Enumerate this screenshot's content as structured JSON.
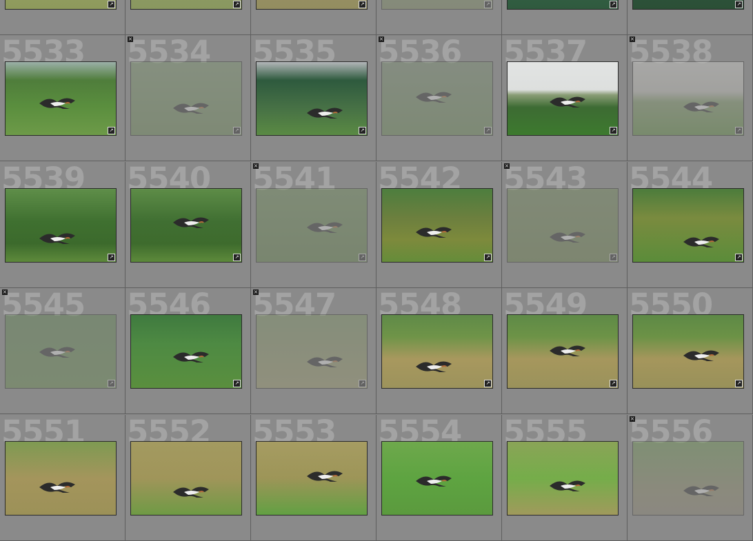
{
  "grid": {
    "cells": [
      {
        "num": "",
        "rejected": false,
        "dim": false,
        "bg": "linear-gradient(180deg,#9aa36a 0%,#8e9a5c 100%)",
        "bird": false,
        "badge": "badge-icon"
      },
      {
        "num": "",
        "rejected": false,
        "dim": false,
        "bg": "linear-gradient(180deg,#98a56a 0%,#899760 100%)",
        "bird": false,
        "badge": "badge-icon"
      },
      {
        "num": "",
        "rejected": false,
        "dim": false,
        "bg": "linear-gradient(180deg,#a49a6c 0%,#938d60 100%)",
        "bird": false,
        "badge": "badge-icon"
      },
      {
        "num": "",
        "rejected": false,
        "dim": true,
        "bg": "linear-gradient(180deg,#85956c 0%,#7e8c60 100%)",
        "bird": false,
        "badge": "badge-icon"
      },
      {
        "num": "",
        "rejected": false,
        "dim": false,
        "bg": "linear-gradient(180deg,#3f6e58 0%,#2f5a3e 100%)",
        "bird": false,
        "badge": "badge-icon"
      },
      {
        "num": "",
        "rejected": false,
        "dim": false,
        "bg": "linear-gradient(180deg,#375f4c 0%,#2b4f36 100%)",
        "bird": false,
        "badge": "badge-icon"
      },
      {
        "num": "5533",
        "rejected": false,
        "dim": false,
        "bg": "linear-gradient(180deg,#9bb0a8 0%,#4f7d3b 25%,#5a8e3e 60%,#6d9a48 100%)",
        "bird": true,
        "badge": "badge-icon"
      },
      {
        "num": "5534",
        "rejected": true,
        "dim": true,
        "bg": "linear-gradient(180deg,#7f9a70 0%,#6d8a55 100%)",
        "bird": true,
        "badge": "badge-icon"
      },
      {
        "num": "5535",
        "rejected": false,
        "dim": false,
        "bg": "linear-gradient(180deg,#b3b6b9 0%,#2e5a3e 25%,#456f45 60%,#5a8a44 100%)",
        "bird": true,
        "badge": "badge-icon"
      },
      {
        "num": "5536",
        "rejected": true,
        "dim": true,
        "bg": "linear-gradient(180deg,#7d9273 0%,#6b8a55 100%)",
        "bird": true,
        "badge": "badge-icon"
      },
      {
        "num": "5537",
        "rejected": false,
        "dim": false,
        "bg": "linear-gradient(180deg,#e2e4e3 0%,#dddfde 38%,#8a9d76 45%,#3d6b33 62%,#3d7a2e 100%)",
        "bird": true,
        "badge": "badge-icon"
      },
      {
        "num": "5538",
        "rejected": true,
        "dim": true,
        "bg": "linear-gradient(180deg,#d8d8d4 0%,#c9c8c1 40%,#7f9a66 55%,#5e8c3e 100%)",
        "bird": true,
        "badge": "badge-icon"
      },
      {
        "num": "5539",
        "rejected": false,
        "dim": false,
        "bg": "linear-gradient(180deg,#5f8e49 0%,#3f7030 45%,#3c6a2c 75%,#5e8a3b 100%)",
        "bird": true,
        "badge": "badge-icon"
      },
      {
        "num": "5540",
        "rejected": false,
        "dim": false,
        "bg": "linear-gradient(180deg,#5d8c47 0%,#406f32 45%,#3e6b2d 75%,#5d8a3b 100%)",
        "bird": true,
        "badge": "badge-icon"
      },
      {
        "num": "5541",
        "rejected": true,
        "dim": true,
        "bg": "linear-gradient(180deg,#6f8e58 0%,#5f7f45 100%)",
        "bird": true,
        "badge": "badge-icon"
      },
      {
        "num": "5542",
        "rejected": false,
        "dim": false,
        "bg": "linear-gradient(180deg,#4d7e3e 0%,#6c7f3e 40%,#7d8a3c 70%,#658c3a 100%)",
        "bird": true,
        "badge": "badge-icon"
      },
      {
        "num": "5543",
        "rejected": true,
        "dim": true,
        "bg": "linear-gradient(180deg,#738a59 0%,#6a8048 100%)",
        "bird": true,
        "badge": "badge-icon"
      },
      {
        "num": "5544",
        "rejected": false,
        "dim": false,
        "bg": "linear-gradient(180deg,#4c7c3c 0%,#7a8b3f 40%,#5b8c3a 100%)",
        "bird": true,
        "badge": "badge-icon"
      },
      {
        "num": "5545",
        "rejected": true,
        "dim": true,
        "bg": "linear-gradient(180deg,#5f8650 0%,#668a4b 100%)",
        "bird": true,
        "badge": "badge-icon"
      },
      {
        "num": "5546",
        "rejected": false,
        "dim": false,
        "bg": "linear-gradient(180deg,#3f7a3f 0%,#4e8a43 40%,#5a8f3e 100%)",
        "bird": true,
        "badge": "badge-icon"
      },
      {
        "num": "5547",
        "rejected": true,
        "dim": true,
        "bg": "linear-gradient(180deg,#7d9562 0%,#9c9a6a 100%)",
        "bird": true,
        "badge": "badge-icon"
      },
      {
        "num": "5548",
        "rejected": false,
        "dim": false,
        "bg": "linear-gradient(180deg,#5f8a48 0%,#6f9448 30%,#a8985e 60%,#9c935c 100%)",
        "bird": true,
        "badge": "badge-icon"
      },
      {
        "num": "5549",
        "rejected": false,
        "dim": false,
        "bg": "linear-gradient(180deg,#5e8a47 0%,#6d9347 30%,#a6975d 60%,#9a925b 100%)",
        "bird": true,
        "badge": "badge-icon"
      },
      {
        "num": "5550",
        "rejected": false,
        "dim": false,
        "bg": "linear-gradient(180deg,#5d8946 0%,#6c9246 30%,#a5965c 60%,#98915a 100%)",
        "bird": true,
        "badge": "badge-icon"
      },
      {
        "num": "5551",
        "rejected": false,
        "dim": false,
        "bg": "linear-gradient(180deg,#7e9a52 0%,#a4955c 50%,#9c9158 100%)",
        "bird": true,
        "badge": ""
      },
      {
        "num": "5552",
        "rejected": false,
        "dim": false,
        "bg": "linear-gradient(180deg,#a39a60 0%,#a0955a 50%,#6f9a45 100%)",
        "bird": true,
        "badge": ""
      },
      {
        "num": "5553",
        "rejected": false,
        "dim": false,
        "bg": "linear-gradient(180deg,#a69c62 0%,#9d9558 50%,#62a043 100%)",
        "bird": true,
        "badge": ""
      },
      {
        "num": "5554",
        "rejected": false,
        "dim": false,
        "bg": "linear-gradient(180deg,#6ea84c 0%,#5ea441 50%,#5b9a3e 100%)",
        "bird": true,
        "badge": ""
      },
      {
        "num": "5555",
        "rejected": false,
        "dim": false,
        "bg": "linear-gradient(180deg,#8aa457 0%,#75ad4a 50%,#a09a5c 100%)",
        "bird": true,
        "badge": ""
      },
      {
        "num": "5556",
        "rejected": true,
        "dim": true,
        "bg": "linear-gradient(180deg,#6f9a52 0%,#8f8a6a 70%,#8c8672 100%)",
        "bird": true,
        "badge": ""
      }
    ]
  },
  "ui": {
    "reject_glyph": "×",
    "badge_glyph": "↗"
  }
}
